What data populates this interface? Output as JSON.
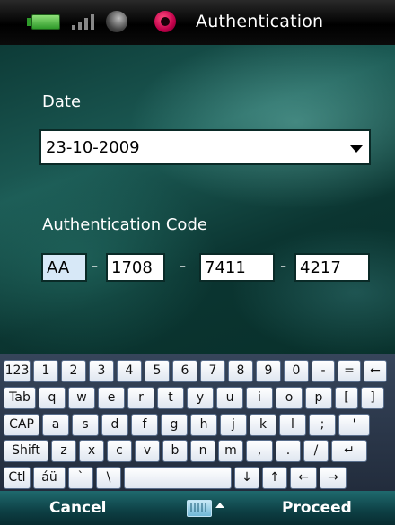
{
  "titlebar": {
    "title": "Authentication",
    "icons": [
      "battery-icon",
      "signal-icon",
      "globe-icon",
      "app-icon"
    ]
  },
  "form": {
    "date_label": "Date",
    "date_value": "23-10-2009",
    "code_label": "Authentication Code",
    "code_parts": [
      "AA",
      "1708",
      "7411",
      "4217"
    ],
    "separator": "-"
  },
  "keyboard": {
    "rows": [
      [
        "123",
        "1",
        "2",
        "3",
        "4",
        "5",
        "6",
        "7",
        "8",
        "9",
        "0",
        "-",
        "=",
        "←"
      ],
      [
        "Tab",
        "q",
        "w",
        "e",
        "r",
        "t",
        "y",
        "u",
        "i",
        "o",
        "p",
        "[",
        "]"
      ],
      [
        "CAP",
        "a",
        "s",
        "d",
        "f",
        "g",
        "h",
        "j",
        "k",
        "l",
        ";",
        "'"
      ],
      [
        "Shift",
        "z",
        "x",
        "c",
        "v",
        "b",
        "n",
        "m",
        ",",
        ".",
        "/",
        "↵"
      ],
      [
        "Ctl",
        "áü",
        "`",
        "\\",
        "",
        "↓",
        "↑",
        "←",
        "→"
      ]
    ]
  },
  "softkeys": {
    "left": "Cancel",
    "right": "Proceed"
  }
}
